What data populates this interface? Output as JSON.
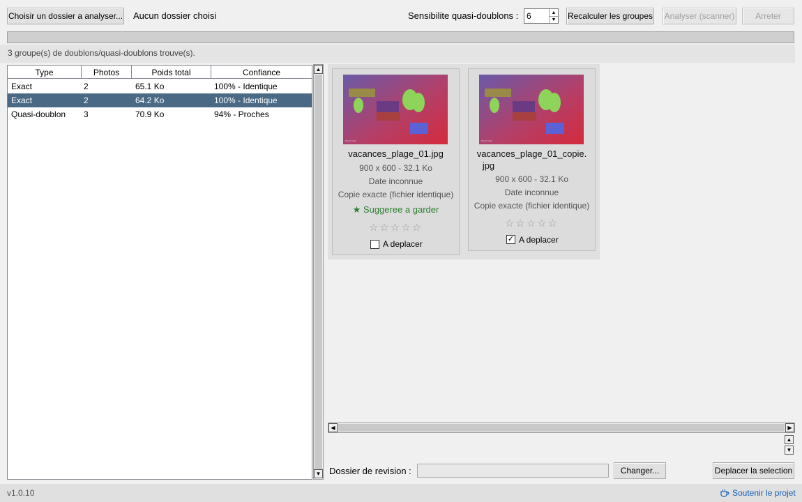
{
  "toolbar": {
    "choose_folder": "Choisir un dossier a analyser...",
    "folder_status": "Aucun dossier choisi",
    "sensitivity_label": "Sensibilite quasi-doublons :",
    "sensitivity_value": "6",
    "recalc": "Recalculer les groupes",
    "analyze": "Analyser (scanner)",
    "stop": "Arreter"
  },
  "status": "3 groupe(s) de doublons/quasi-doublons trouve(s).",
  "table": {
    "headers": [
      "Type",
      "Photos",
      "Poids total",
      "Confiance"
    ],
    "rows": [
      {
        "type": "Exact",
        "photos": "2",
        "size": "65.1 Ko",
        "confidence": "100% - Identique",
        "selected": false
      },
      {
        "type": "Exact",
        "photos": "2",
        "size": "64.2 Ko",
        "confidence": "100% - Identique",
        "selected": true
      },
      {
        "type": "Quasi-doublon",
        "photos": "3",
        "size": "70.9 Ko",
        "confidence": "94% - Proches",
        "selected": false
      }
    ]
  },
  "cards": [
    {
      "filename_line1": "vacances_plage_01.jpg",
      "filename_line2": "",
      "dimensions": "900 x 600 - 32.1 Ko",
      "date": "Date inconnue",
      "kind": "Copie exacte (fichier identique)",
      "keep_label": "★ Suggeree a garder",
      "stars": "☆☆☆☆☆",
      "move_label": "A deplacer",
      "move_checked": false,
      "thumb_caption": "Photo test"
    },
    {
      "filename_line1": "vacances_plage_01_copie.",
      "filename_line2": "jpg",
      "dimensions": "900 x 600 - 32.1 Ko",
      "date": "Date inconnue",
      "kind": "Copie exacte (fichier identique)",
      "keep_label": "",
      "stars": "☆☆☆☆☆",
      "move_label": "A deplacer",
      "move_checked": true,
      "thumb_caption": "Photo test"
    }
  ],
  "bottom": {
    "review_label": "Dossier de revision :",
    "review_value": "",
    "change": "Changer...",
    "move_selection": "Deplacer la selection"
  },
  "footer": {
    "version": "v1.0.10",
    "support": "Soutenir le projet"
  },
  "colors": {
    "selected_row": "#4a6984",
    "keep_green": "#2e7d32",
    "link_blue": "#1a5fb4"
  },
  "icons": {
    "spin_up": "triangle-up",
    "spin_down": "triangle-down",
    "support": "cup-icon"
  }
}
